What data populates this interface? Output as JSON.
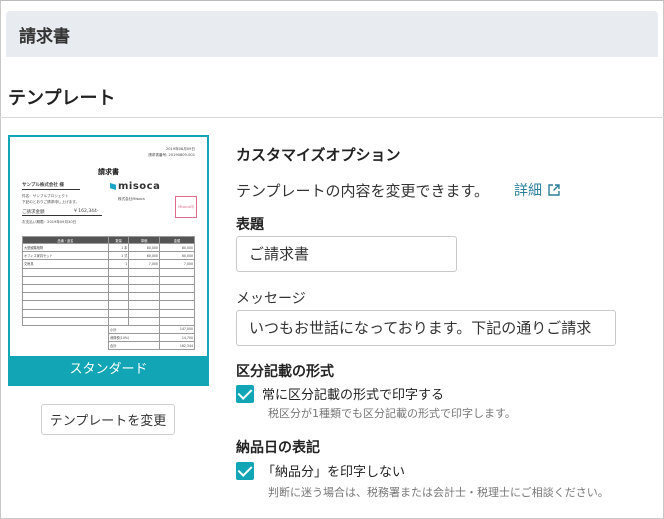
{
  "header": {
    "title": "請求書"
  },
  "section": {
    "title": "テンプレート"
  },
  "template": {
    "name": "スタンダード",
    "change_button": "テンプレートを変更",
    "preview": {
      "date1": "2019年08月09日",
      "date2": "請求書番号: 20190809-001",
      "doc_title": "請求書",
      "client": "サンプル株式会社 様",
      "subject": "件名：サンプルプロジェクト",
      "note": "下記のとおりご請求申し上げます。",
      "amount_label": "ご請求金額",
      "amount": "¥ 162,344-",
      "due": "お支払い期限：2019年09月30日",
      "brand": "misoca",
      "company": "株式会社Misoca",
      "stamp": "Misoca印",
      "headers": [
        "品番・品名",
        "数量",
        "単価",
        "金額"
      ],
      "rows": [
        [
          "大型観葉植物",
          "1 本",
          "80,000",
          "80,000"
        ],
        [
          "オフィス家具セット",
          "1 式",
          "60,000",
          "60,000"
        ],
        [
          "文房具",
          "1",
          "7,000",
          "7,000"
        ]
      ],
      "totals": [
        [
          "小計",
          "",
          "",
          "147,000"
        ],
        [
          "消費税(10%)",
          "",
          "",
          "14,700"
        ],
        [
          "合計",
          "",
          "",
          "162,344"
        ]
      ]
    }
  },
  "options": {
    "title": "カスタマイズオプション",
    "description": "テンプレートの内容を変更できます。",
    "detail_link": "詳細",
    "subject_label": "表題",
    "subject_value": "ご請求書",
    "message_label": "メッセージ",
    "message_value": "いつもお世話になっております。下記の通りご請求",
    "kubun_label": "区分記載の形式",
    "kubun_check": "常に区分記載の形式で印字する",
    "kubun_help": "税区分が1種類でも区分記載の形式で印字します。",
    "delivery_label": "納品日の表記",
    "delivery_check": "「納品分」を印字しない",
    "delivery_help": "判断に迷う場合は、税務署または会計士・税理士にご相談ください。"
  },
  "colors": {
    "accent": "#12a5b5",
    "link": "#2b7f9a",
    "header_bg": "#e8ecf0"
  }
}
